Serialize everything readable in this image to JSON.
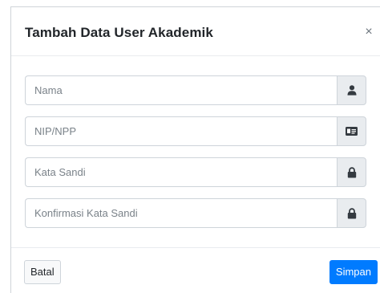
{
  "modal": {
    "title": "Tambah Data User Akademik",
    "close_label": "×"
  },
  "form": {
    "fields": [
      {
        "placeholder": "Nama",
        "value": "",
        "icon": "user-icon"
      },
      {
        "placeholder": "NIP/NPP",
        "value": "",
        "icon": "id-card-icon"
      },
      {
        "placeholder": "Kata Sandi",
        "value": "",
        "icon": "lock-icon"
      },
      {
        "placeholder": "Konfirmasi Kata Sandi",
        "value": "",
        "icon": "lock-icon"
      }
    ]
  },
  "footer": {
    "cancel_label": "Batal",
    "save_label": "Simpan"
  },
  "colors": {
    "primary": "#007bff",
    "addon_bg": "#e9ecef",
    "border": "#ced4da"
  }
}
